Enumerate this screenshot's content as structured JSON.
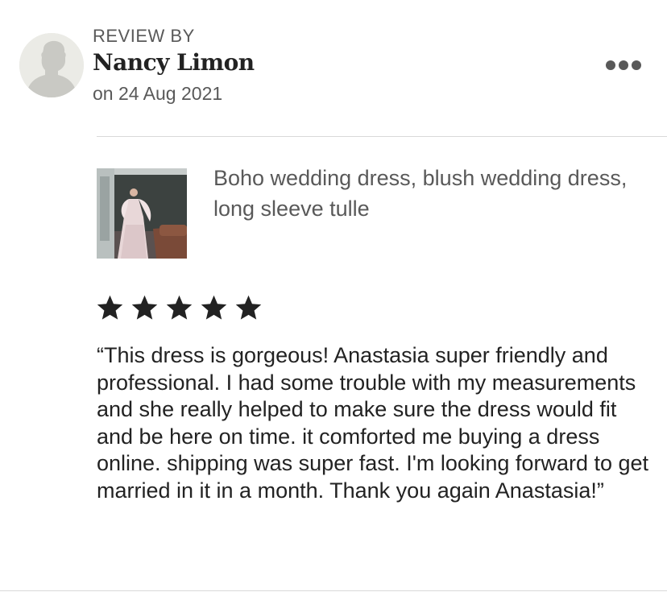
{
  "review": {
    "header_label": "REVIEW BY",
    "reviewer_name": "Nancy Limon",
    "date": "on 24 Aug 2021",
    "rating": 5,
    "rating_max": 5,
    "text": "“This dress is gorgeous! Anastasia super friendly and professional. I had some trouble with my measurements and she really helped to make sure the dress would fit and be here on time. it comforted me buying a dress online. shipping was super fast. I'm looking forward to get married in it in a month. Thank you again Anastasia!”"
  },
  "listing": {
    "title": "Boho wedding dress, blush wedding dress, long sleeve tulle"
  },
  "icons": {
    "avatar": "person-silhouette-icon",
    "more": "more-horizontal-icon",
    "star": "star-icon"
  },
  "colors": {
    "text_primary": "#222222",
    "text_secondary": "#595959",
    "divider": "#d9d9d9",
    "star": "#222222"
  }
}
